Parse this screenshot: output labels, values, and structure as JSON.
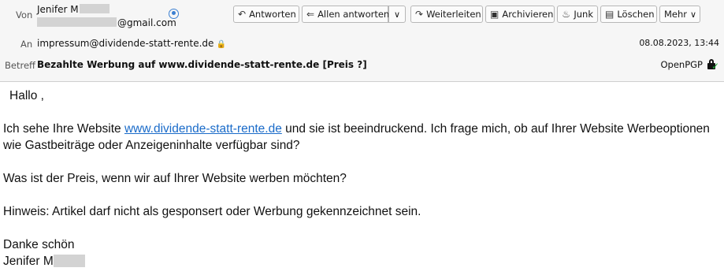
{
  "header": {
    "from_label": "Von",
    "from_name": "Jenifer M",
    "from_email_suffix": "@gmail.com",
    "to_label": "An",
    "to_address": "impressum@dividende-statt-rente.de",
    "date": "08.08.2023, 13:44",
    "subject_label": "Betreff",
    "subject": "Bezahlte Werbung auf www.dividende-statt-rente.de [Preis ?]",
    "openpgp_label": "OpenPGP"
  },
  "toolbar": {
    "reply": "Antworten",
    "reply_all": "Allen antworten",
    "forward": "Weiterleiten",
    "archive": "Archivieren",
    "junk": "Junk",
    "delete": "Löschen",
    "more": "Mehr"
  },
  "body": {
    "greeting": "Hallo ,",
    "p1_start": "Ich sehe Ihre Website ",
    "p1_link": "www.dividende-statt-rente.de",
    "p1_end": " und sie ist beeindruckend. Ich frage mich, ob auf Ihrer Website Werbeoptionen wie Gastbeiträge oder Anzeigeninhalte verfügbar sind?",
    "p2": "Was ist der Preis, wenn wir auf Ihrer Website werben möchten?",
    "p3": "Hinweis: Artikel darf nicht als gesponsert oder Werbung gekennzeichnet sein.",
    "closing": "Danke schön",
    "signature_name": "Jenifer M"
  }
}
